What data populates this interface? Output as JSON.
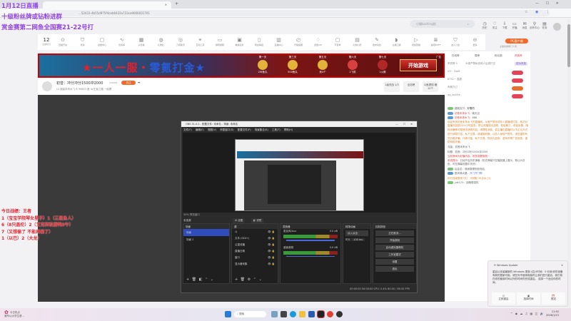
{
  "browser": {
    "tab_title": "",
    "url": "...52431-4b55d975f4ceb6422a733ce9000031701",
    "window": [
      "—",
      "☐",
      "✕"
    ]
  },
  "overlay": {
    "top_lines": [
      "1月12日直播",
      "十级粉丝牌或钻粉进群",
      "赏金赛第二网鱼全国赛21-22号打"
    ],
    "record_lines": [
      "今日战绩：王者",
      "1（宝宝学院琴女星子）1（三星鱼人）",
      "6（8只盖伦）2（艾克转驳盾鸭9午）",
      "7（又想偷了 不能再偷了）",
      "1（以巴）2（大龙）"
    ]
  },
  "header": {
    "search_placeholder": "小猫kaching前",
    "icons": [
      {
        "name": "history",
        "label": "历史"
      },
      {
        "name": "follow",
        "label": "关注"
      },
      {
        "name": "download",
        "label": "下载"
      },
      {
        "name": "broadcast",
        "label": "开播"
      },
      {
        "name": "message",
        "label": "消息"
      },
      {
        "name": "creator",
        "label": "创作中心"
      },
      {
        "name": "task",
        "label": "任务"
      }
    ]
  },
  "toolbar": {
    "level": "12",
    "level_label": "主播积分",
    "items": [
      "直播开关",
      "月榜",
      "勋章中心",
      "表情库",
      "头衔墙",
      "礼物栏",
      "刀塔助手",
      "互动工具",
      "弹幕屏蔽",
      "看播任务",
      "粉丝等级",
      "直播中心",
      "开播提醒",
      "贵族VIP",
      "节目单",
      "礼物心愿",
      "发布动态",
      "主播口袋",
      "视频回播",
      "鱼吧BUFF",
      "进入公会",
      "更多"
    ],
    "pc_button": "PC客户端",
    "pc_sub": "主播热推看门人场"
  },
  "banner": {
    "title_red": "★一人一服・",
    "title_blue": "零氪打金★",
    "days": [
      {
        "label": "第一天",
        "reward": "2W鱼丸"
      },
      {
        "label": "第三天",
        "reward": "500鱼丸"
      },
      {
        "label": "第五天",
        "reward": "贡4个"
      },
      {
        "label": "第六天",
        "reward": "1飞机"
      },
      {
        "label": "第七天",
        "reward": "1火箭"
      }
    ],
    "cta": "开始游戏",
    "ad": "广告"
  },
  "streamer": {
    "title": "初音：冲分冲分1500冲2000",
    "room_id": "446058",
    "follow": "关注",
    "meta": "LV  超级未来水飞   ♁ 99603   鱼 lol王者之路   一起看",
    "buttons": [
      "1级洗战 1/3",
      "全站榜",
      "斗鱼提现 赚10个"
    ]
  },
  "obs": {
    "title": "OBS 31.0.2 - 配置文件: 未命名 - 场景: 未命名",
    "menu": [
      "文件(F)",
      "编辑(E)",
      "视图(V)",
      "停靠窗口(D)",
      "配置文件(P)",
      "场景集合(S)",
      "工具(T)",
      "帮助(H)"
    ],
    "zoom": "30%  预览窗口",
    "no_source": "未选源",
    "tab_props": "⚙ 设置",
    "tab_filters": "◧ 滤镜",
    "scenes_title": "场景",
    "scenes": [
      "场景",
      "场景 2"
    ],
    "sources_title": "源",
    "sources": [
      "斗",
      "文本 (GDI+)",
      "云直线播",
      "直播日期",
      "窗口",
      "显示器采集"
    ],
    "mixer_title": "混音器",
    "mixer": [
      {
        "name": "麦克风/Aux",
        "db": "0.0 dB"
      },
      {
        "name": "桌面音频",
        "db": "0.0 dB"
      }
    ],
    "trans_title": "转场动画",
    "trans_value": "淡入淡出",
    "duration_label": "时长",
    "duration": "100 ms",
    "controls_title": "控制按钮",
    "controls": [
      "正在推流…",
      "开始录制",
      "启动虚拟摄像机",
      "工作室模式",
      "设置",
      "退出"
    ],
    "status": "00:00:00   00:00:00   CPU: 0.4%   60.00 / 60.00 FPS"
  },
  "chat": {
    "tabs": [
      "在线榜",
      "周榜",
      "粉丝团",
      "贵族榜"
    ],
    "rank_note": "贵宾榜 5",
    "rank_tip": "大佬严禁私信他人后退打空",
    "rank_btn": "成为贵族",
    "ranks": [
      "VG~ Swift",
      "8752~ 靠靠",
      "布朗方订",
      "qq_kpcfeh"
    ],
    "messages": [
      {
        "user": "路路支付",
        "text": "好着的"
      },
      {
        "user": "初音未来水飞",
        "text": "晚天见"
      },
      {
        "user": "初音未来水飞",
        "text": "888"
      },
      {
        "user": "",
        "text": "欢迎来到初音未来水飞的直播间。斗鱼严禁未成年人直播或打赏，依法对直播内容进行24小时巡查。禁止传播违法违规、低俗暴力、低俗色情、暗网涉嫌等可疑违法违规内容。请理性消费，如主播在直播时以不正当方式进行诱导打赏、私下交易、请谨慎判断，以防人身财产损失。请您谨防有关价格诈骗、代练代抽、私下交易、购买礼品码、游戏币等广告信息，谨防网络诈骗。"
      },
      {
        "user": "流量",
        "text": "初音未来水飞"
      },
      {
        "user": "标题",
        "text": "初音：冲分冲分1500冲2000"
      },
      {
        "user": "",
        "text": "当前房间为彩播内容，祝您观看愉快~"
      },
      {
        "user": "系统提示",
        "text": "已经开启历史弹幕（历史弹幕只在播放器上展示，默认为灰色，可在弹幕设置中关闭）"
      },
      {
        "user": "后会友",
        "text": "我家路便相信而后，"
      },
      {
        "user": "愿风骑大路",
        "text": "开门开门啊"
      },
      {
        "user": "",
        "text": "你已连续登录7天！ 可领取 30点水 [3]"
      },
      {
        "user": "ydt123",
        "text": "战略很强的"
      }
    ]
  },
  "notification": {
    "title": "Windows Update",
    "body": "重启以安装最新的 Windows 更新 (估计时间：3 分钟)你的设备有新的更新可用。请在你不使用电脑时让我们进行重启，我们将在你的使用时间以外的时间内完成重启。 选择一个适合你的时间。",
    "buttons": [
      "立即重启",
      "选择时间",
      "推迟"
    ]
  },
  "taskbar": {
    "news": "今日热点",
    "news_sub": "某所以大学生退…",
    "search": "搜索",
    "time": "11:52",
    "date": "2026/1/13"
  }
}
